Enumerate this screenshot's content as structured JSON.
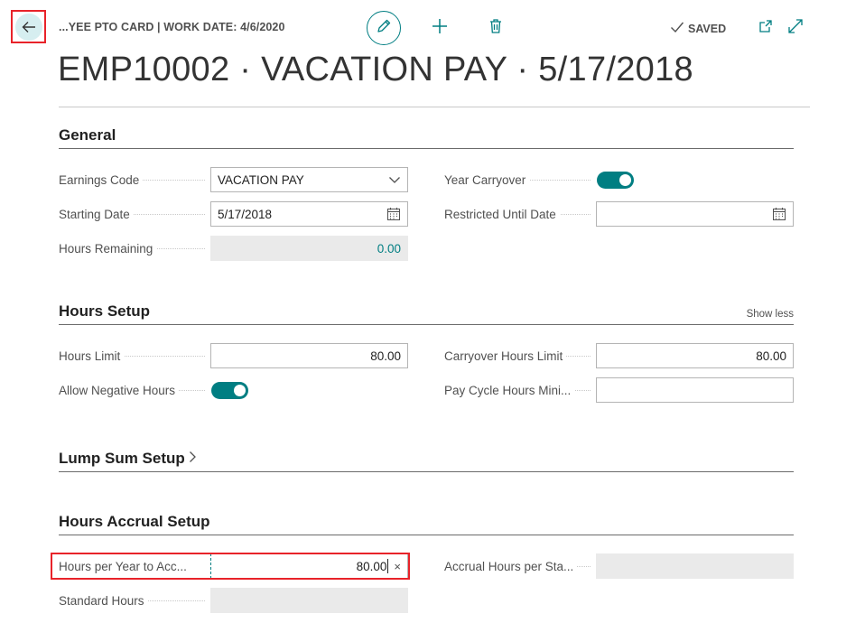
{
  "header": {
    "breadcrumb": "...YEE PTO CARD | WORK DATE: 4/6/2020",
    "saved_label": "SAVED"
  },
  "page_title": "EMP10002 · VACATION PAY · 5/17/2018",
  "sections": {
    "general": {
      "title": "General",
      "earnings_code": {
        "label": "Earnings Code",
        "value": "VACATION PAY"
      },
      "starting_date": {
        "label": "Starting Date",
        "value": "5/17/2018"
      },
      "hours_remaining": {
        "label": "Hours Remaining",
        "value": "0.00"
      },
      "year_carryover": {
        "label": "Year Carryover",
        "checked": true
      },
      "restricted_until_date": {
        "label": "Restricted Until Date",
        "value": ""
      }
    },
    "hours_setup": {
      "title": "Hours Setup",
      "show_less": "Show less",
      "hours_limit": {
        "label": "Hours Limit",
        "value": "80.00"
      },
      "allow_negative_hours": {
        "label": "Allow Negative Hours",
        "checked": true
      },
      "carryover_hours_limit": {
        "label": "Carryover Hours Limit",
        "value": "80.00"
      },
      "pay_cycle_hours_min": {
        "label": "Pay Cycle Hours Mini...",
        "value": ""
      }
    },
    "lump_sum_setup": {
      "title": "Lump Sum Setup"
    },
    "hours_accrual_setup": {
      "title": "Hours Accrual Setup",
      "hours_per_year": {
        "label": "Hours per Year to Acc...",
        "value": "80.00"
      },
      "standard_hours": {
        "label": "Standard Hours",
        "value": ""
      },
      "accrual_hours_per_sta": {
        "label": "Accrual Hours per Sta...",
        "value": ""
      }
    }
  },
  "colors": {
    "accent": "#007e82",
    "highlight": "#e8232a",
    "readonly_bg": "#eaeaea"
  }
}
